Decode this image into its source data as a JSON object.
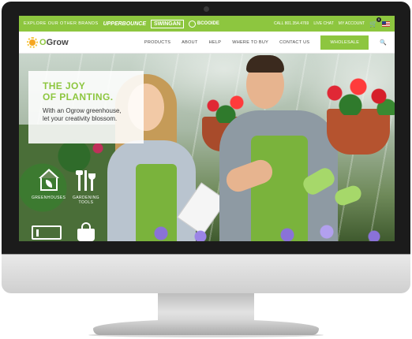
{
  "topbar": {
    "explore": "EXPLORE OUR OTHER BRANDS",
    "brands": [
      "UPPERBOUNCE",
      "SWINGAN",
      "BCOOIDE"
    ],
    "call": "CALL 801.354.4769",
    "live_chat": "LIVE CHAT",
    "my_account": "MY ACCOUNT",
    "cart_count": "0",
    "cart_icon": "shopping-cart-icon",
    "flag_icon": "us-flag-icon"
  },
  "nav": {
    "logo": {
      "first": "O",
      "rest": "Grow"
    },
    "links": [
      "PRODUCTS",
      "ABOUT",
      "HELP",
      "WHERE TO BUY",
      "CONTACT US",
      "WHOLESALE"
    ],
    "search_icon": "search-icon"
  },
  "hero": {
    "title_line1": "THE JOY",
    "title_line2": "OF PLANTING.",
    "subtitle_line1": "With an Ogrow greenhouse,",
    "subtitle_line2": "let your creativity blossom."
  },
  "categories": [
    {
      "label": "GREENHOUSES",
      "icon": "greenhouse-icon"
    },
    {
      "label_line1": "GARDENING",
      "label_line2": "TOOLS",
      "icon": "gardening-tools-icon"
    }
  ],
  "colors": {
    "accent": "#8dc63f",
    "bezel": "#1b1b1b",
    "text": "#444444"
  }
}
